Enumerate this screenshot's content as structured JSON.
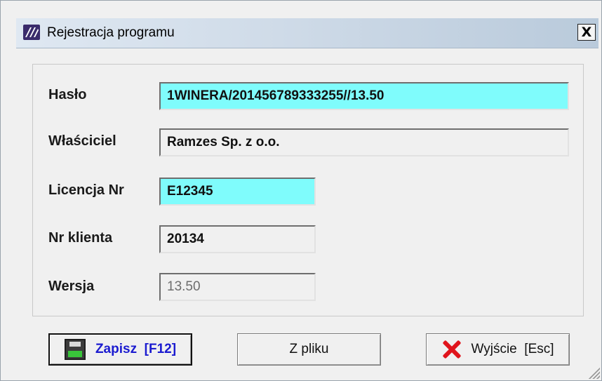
{
  "window": {
    "title": "Rejestracja programu",
    "close_label": "X"
  },
  "fields": {
    "haslo": {
      "label": "Hasło",
      "value": "1WINERA/201456789333255//13.50"
    },
    "wlasciciel": {
      "label": "Właściciel",
      "value": "Ramzes Sp. z o.o."
    },
    "licencja": {
      "label": "Licencja Nr",
      "value": "E12345"
    },
    "klient": {
      "label": "Nr klienta",
      "value": "20134"
    },
    "wersja": {
      "label": "Wersja",
      "value": "13.50"
    }
  },
  "buttons": {
    "save_label": "Zapisz  [F12]",
    "from_file_label": "Z pliku",
    "exit_label": "Wyjście  [Esc]"
  },
  "icons": {
    "app": "program-logo-icon",
    "save": "floppy-disk-icon",
    "exit": "red-x-icon"
  },
  "colors": {
    "editable_field": "#7ffcfc",
    "save_label": "#1b1bd0",
    "exit_icon": "#e0141c"
  }
}
